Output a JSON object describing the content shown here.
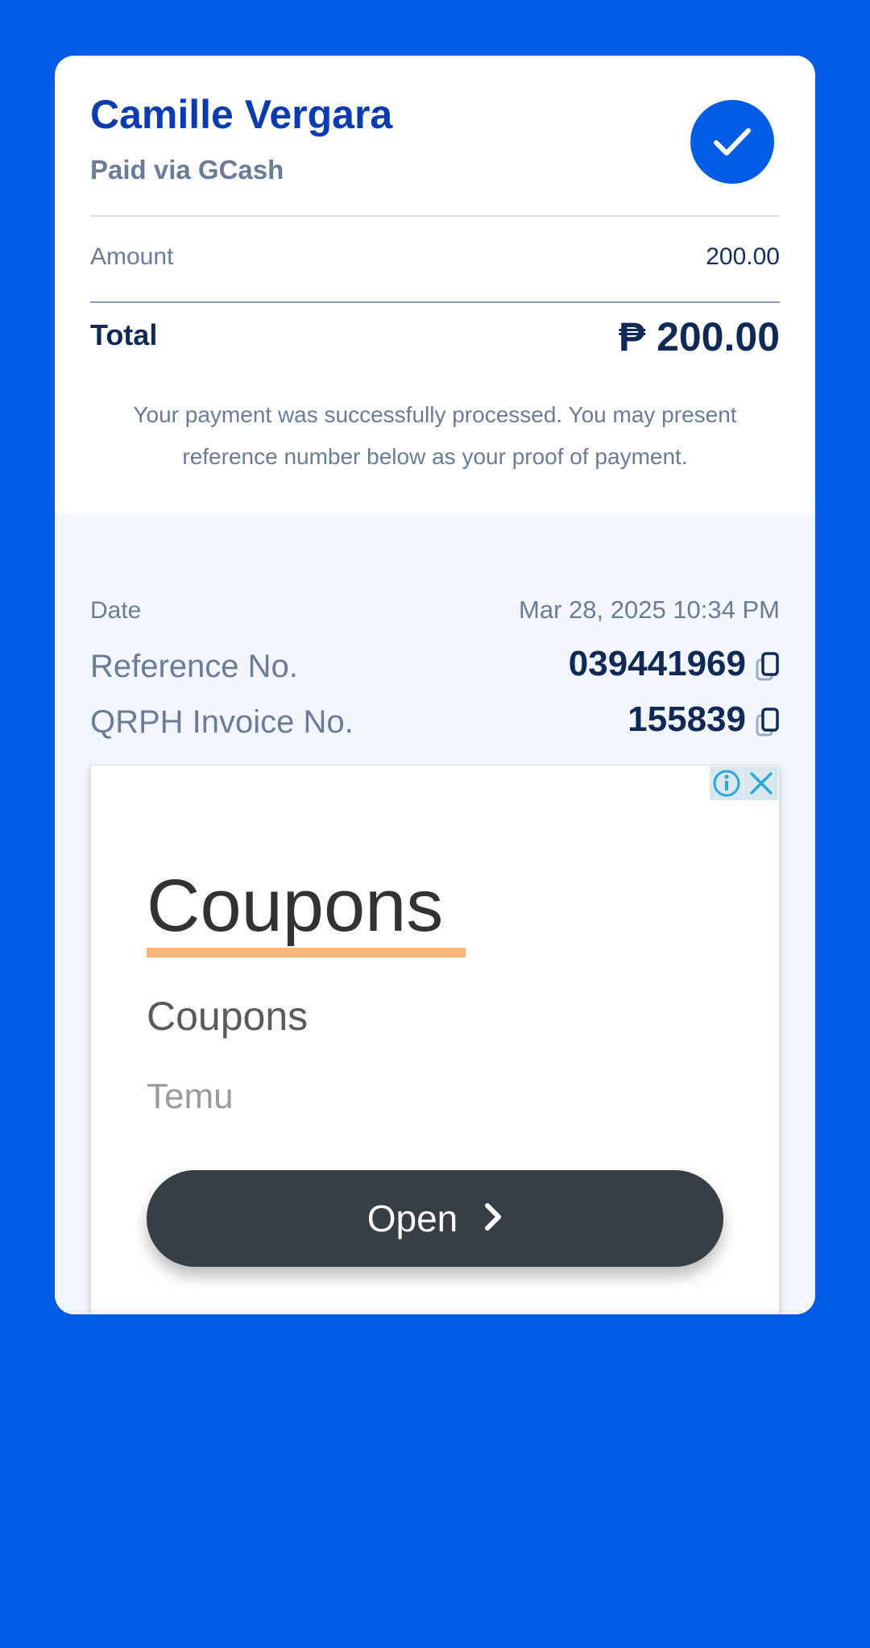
{
  "receipt": {
    "merchant_name": "Camille Vergara",
    "paid_via": "Paid via GCash",
    "status_icon": "check-icon",
    "amount_label": "Amount",
    "amount_value": "200.00",
    "total_label": "Total",
    "total_value": "₱ 200.00",
    "success_message": "Your payment was successfully processed. You may present reference number below as your proof of payment."
  },
  "details": {
    "date_label": "Date",
    "date_value": "Mar 28, 2025 10:34 PM",
    "reference_label": "Reference No.",
    "reference_value": "039441969",
    "invoice_label": "QRPH Invoice No.",
    "invoice_value": "155839"
  },
  "ad": {
    "title": "Coupons",
    "subtitle": "Coupons",
    "advertiser": "Temu",
    "button_label": "Open",
    "info_icon": "info-icon",
    "close_icon": "close-icon"
  },
  "colors": {
    "background": "#005ce5",
    "accent_title": "#0a3bb0",
    "text_dark": "#0f2a57",
    "text_muted": "#6a7c98",
    "ad_button": "#363f46",
    "ad_underline": "#f7b77a"
  }
}
